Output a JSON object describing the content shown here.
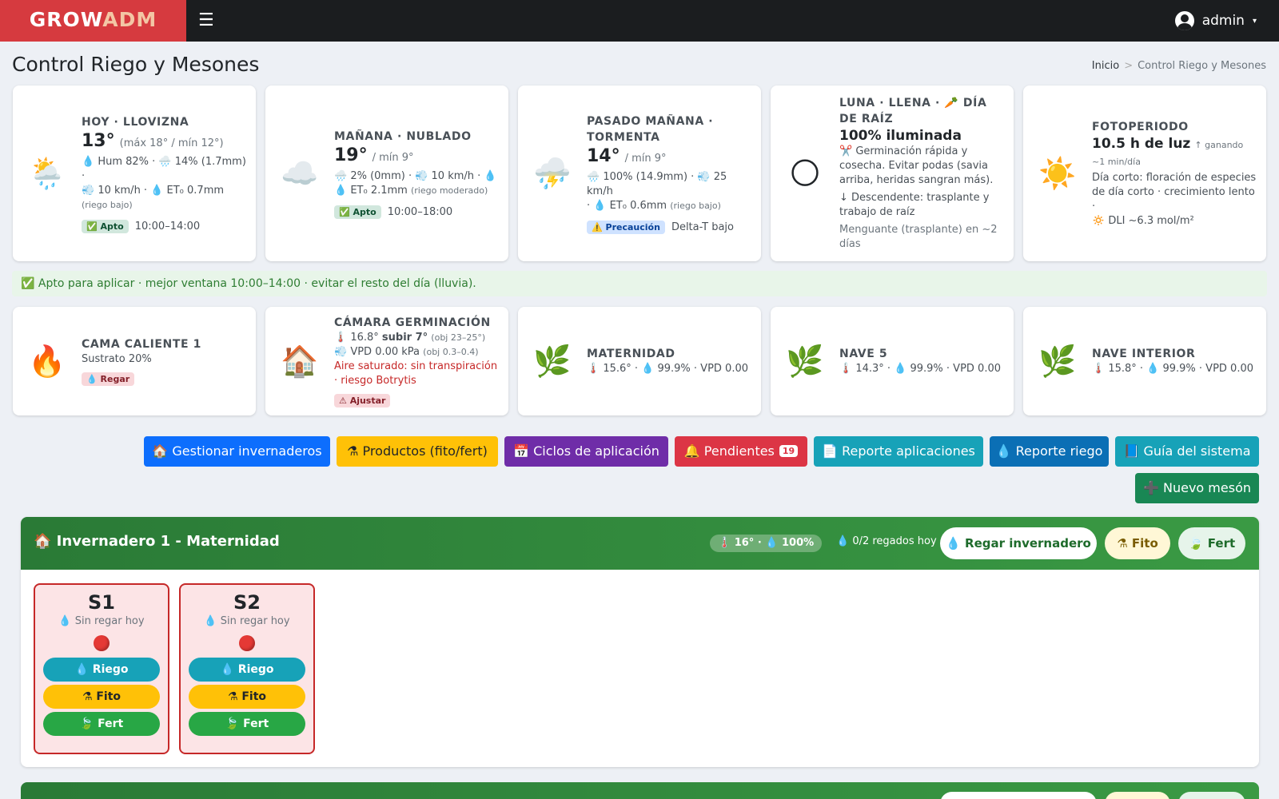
{
  "brand": {
    "part1": "GROW",
    "part2": "ADM"
  },
  "topbar": {
    "menu_icon": "☰",
    "user_name": "admin",
    "caret": "▾"
  },
  "page": {
    "title": "Control Riego y Mesones"
  },
  "breadcrumb": {
    "home": "Inicio",
    "sep": ">",
    "current": "Control Riego y Mesones"
  },
  "weather": [
    {
      "icon": "🌦️",
      "label": "HOY · LLOVIZNA",
      "temp": "13°",
      "range": "(máx 18° / mín 12°)",
      "line1": "💧 Hum 82% · 🌧️ 14% (1.7mm) ·",
      "line2": "💨 10 km/h · 💧 ET₀ 0.7mm",
      "note": "(riego bajo)",
      "badge": "✅ Apto",
      "window": "10:00–14:00"
    },
    {
      "icon": "☁️",
      "label": "MAÑANA · NUBLADO",
      "temp": "19°",
      "range": "/ mín 9°",
      "line1": "🌧️ 2% (0mm) · 💨 10 km/h · 💧",
      "line2": "💧 ET₀ 2.1mm",
      "note": "(riego moderado)",
      "badge": "✅ Apto",
      "window": "10:00–18:00"
    },
    {
      "icon": "⛈️",
      "label": "PASADO MAÑANA · TORMENTA",
      "temp": "14°",
      "range": "/ mín 9°",
      "line1": "🌧️ 100% (14.9mm) · 💨 25 km/h",
      "line2": "· 💧 ET₀ 0.6mm",
      "note": "(riego bajo)",
      "badge": "⚠️ Precaución",
      "window": "Delta-T bajo"
    }
  ],
  "moon": {
    "icon": "🌕",
    "label": "LUNA · LLENA · 🥕 DÍA DE RAÍZ",
    "big": "100% iluminada",
    "l1": "✂️ Germinación rápida y cosecha. Evitar podas (savia arriba, heridas sangran más).",
    "l2": "↓ Descendente: trasplante y trabajo de raíz",
    "l3": "Menguante (trasplante) en ~2 días"
  },
  "photo": {
    "icon": "☀️",
    "label": "FOTOPERIODO",
    "big": "10.5 h de luz",
    "gain": "↑ ganando ~1 min/día",
    "l1": "Día corto: floración de especies de día corto · crecimiento lento ·",
    "l2": "🔅 DLI ~6.3 mol/m²"
  },
  "alert": {
    "text": "✅ Apto para aplicar · mejor ventana 10:00–14:00 · evitar el resto del día (lluvia)."
  },
  "env": {
    "cama": {
      "icon": "🔥",
      "label": "CAMA CALIENTE 1",
      "line": "Sustrato 20%",
      "badge": "💧 Regar"
    },
    "camara": {
      "icon": "🏠",
      "label": "CÁMARA GERMINACIÓN",
      "temp_line": "🌡️ 16.8°",
      "temp_action": "subir 7°",
      "temp_obj": "(obj 23–25°)",
      "vpd_line": "💨 VPD 0.00 kPa",
      "vpd_obj": "(obj 0.3–0.4)",
      "warn": "Aire saturado: sin transpiración",
      "warn2": "· riesgo Botrytis",
      "badge": "⚠ Ajustar"
    },
    "rooms": [
      {
        "icon": "🌿",
        "label": "MATERNIDAD",
        "line": "🌡️ 15.6° · 💧 99.9% · VPD 0.00"
      },
      {
        "icon": "🌿",
        "label": "NAVE 5",
        "line": "🌡️ 14.3° · 💧 99.9% · VPD 0.00"
      },
      {
        "icon": "🌿",
        "label": "NAVE INTERIOR",
        "line": "🌡️ 15.8° · 💧 99.9% · VPD 0.00"
      }
    ]
  },
  "actions": {
    "gestionar": "🏠 Gestionar invernaderos",
    "productos": "⚗ Productos (fito/fert)",
    "ciclos": "📅 Ciclos de aplicación",
    "pendientes": "🔔 Pendientes",
    "pendientes_count": "19",
    "rep_apl": "📄 Reporte aplicaciones",
    "rep_riego": "💧 Reporte riego",
    "guia": "📘 Guía del sistema",
    "nuevo": "➕ Nuevo mesón"
  },
  "colors": {
    "primary": "#0d6efd",
    "warning": "#ffc107",
    "purple": "#6f2da8",
    "danger": "#dc3545",
    "info": "#17a2b8",
    "blue": "#0b6fb5",
    "success": "#198754",
    "green_header": "#2e8b3e"
  },
  "greenhouse": {
    "title": "🏠 Invernadero 1 - Maternidad",
    "env": "🌡️ 16° · 💧 100%",
    "regados": "💧 0/2 regados hoy",
    "btn_regar": "💧 Regar invernadero",
    "btn_fito": "⚗ Fito",
    "btn_fert": "🍃 Fert",
    "beds": [
      {
        "name": "S1",
        "status": "💧 Sin regar hoy",
        "riego": "💧 Riego",
        "fito": "⚗ Fito",
        "fert": "🍃 Fert"
      },
      {
        "name": "S2",
        "status": "💧 Sin regar hoy",
        "riego": "💧 Riego",
        "fito": "⚗ Fito",
        "fert": "🍃 Fert"
      }
    ]
  }
}
